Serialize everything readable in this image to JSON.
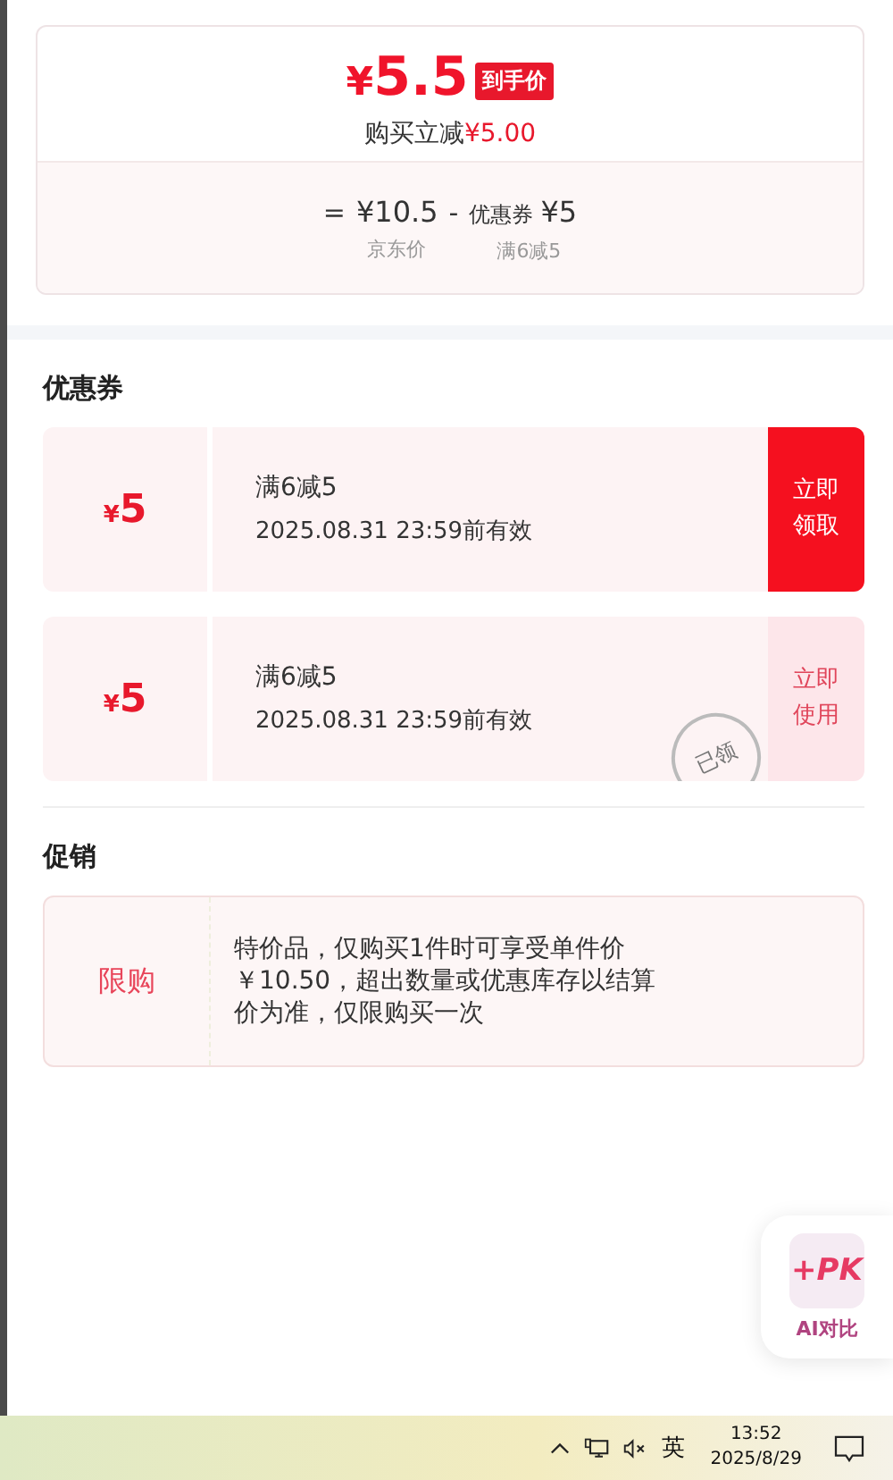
{
  "price_card": {
    "price": "¥5.5",
    "price_tag": "到手价",
    "saving": "购买立减**¥5.00**",
    "breakdown": [
      {
        "operator": "=",
        "value": "¥10.5",
        "caption": "京东价"
      },
      {
        "operator": "-",
        "name": "优惠券",
        "value": "¥5",
        "caption": "满6减5"
      }
    ]
  },
  "coupons": {
    "title": "优惠券",
    "items": [
      {
        "amount": "¥5",
        "rule": "满6减5",
        "validity": "2025.08.31 23:59前有效",
        "action": "立即领取",
        "claimed": false
      },
      {
        "amount": "¥5",
        "rule": "满6减5",
        "validity": "2025.08.31 23:59前有效",
        "action": "立即使用",
        "claimed": true,
        "stamp": "已领"
      }
    ]
  },
  "promotions": {
    "title": "促销",
    "items": [
      {
        "tag": "限购",
        "text": "特价品，仅购买1件时可享受单件价￥10.50，超出数量或优惠库存以结算价为准，仅限购买一次"
      }
    ]
  },
  "compare_button": {
    "badge": "+PK",
    "label": "AI对比"
  },
  "taskbar": {
    "ime": "英",
    "time": "13:52",
    "date": "2025/8/29"
  }
}
